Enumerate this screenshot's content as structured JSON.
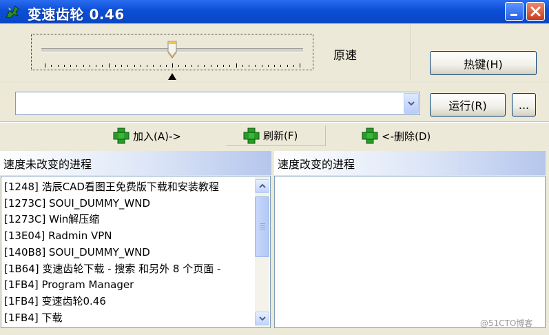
{
  "window": {
    "title": "变速齿轮 0.46"
  },
  "speed": {
    "label": "原速",
    "level_fraction": 0.5
  },
  "buttons": {
    "hotkey": "热键(H)",
    "run": "运行(R)",
    "more": "..."
  },
  "combo": {
    "value": ""
  },
  "actions": {
    "add": "加入(A)->",
    "refresh": "刷新(F)",
    "remove": "<-删除(D)"
  },
  "panels": {
    "left_header": "速度未改变的进程",
    "right_header": "速度改变的进程",
    "left_items": [
      "[1248] 浩辰CAD看图王免费版下载和安装教程",
      "[1273C] SOUI_DUMMY_WND",
      "[1273C] Win解压缩",
      "[13E04] Radmin VPN",
      "[140B8] SOUI_DUMMY_WND",
      "[1B64] 变速齿轮下载 - 搜索 和另外 8 个页面 -",
      "[1FB4] Program Manager",
      "[1FB4] 变速齿轮0.46",
      "[1FB4] 下载"
    ],
    "right_items": []
  },
  "watermark": "@51CTO博客",
  "colors": {
    "titlebar": "#0b4fd6",
    "window_bg": "#ece9d8",
    "plus_icon": "#2a9a2a"
  }
}
